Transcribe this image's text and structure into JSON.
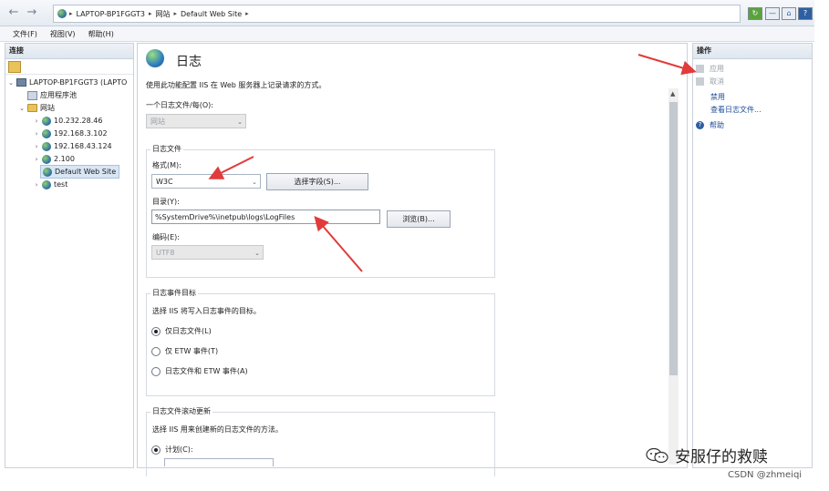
{
  "address": {
    "breadcrumbs": [
      "LAPTOP-BP1FGGT3",
      "网站",
      "Default Web Site"
    ],
    "separator": "▸"
  },
  "menu": [
    "文件(F)",
    "视图(V)",
    "帮助(H)"
  ],
  "connections": {
    "title": "连接",
    "tree": [
      {
        "label": "LAPTOP-BP1FGGT3 (LAPTO",
        "icon": "computer-icon"
      },
      {
        "label": "应用程序池",
        "icon": "app-pool-icon"
      },
      {
        "label": "网站",
        "icon": "folder-icon"
      },
      {
        "label": "10.232.28.46",
        "icon": "globe-icon"
      },
      {
        "label": "192.168.3.102",
        "icon": "globe-icon"
      },
      {
        "label": "192.168.43.124",
        "icon": "globe-icon"
      },
      {
        "label": "2.100",
        "icon": "globe-icon"
      },
      {
        "label": "Default Web Site",
        "icon": "globe-icon"
      },
      {
        "label": "test",
        "icon": "globe-icon"
      }
    ]
  },
  "page": {
    "title": "日志",
    "description": "使用此功能配置 IIS 在 Web 服务器上记录请求的方式。",
    "one_log_per_label": "一个日志文件/每(O):",
    "one_log_per_value": "网站",
    "log_file_group": "日志文件",
    "format_label": "格式(M):",
    "format_value": "W3C",
    "select_fields_button": "选择字段(S)...",
    "directory_label": "目录(Y):",
    "directory_value": "%SystemDrive%\\inetpub\\logs\\LogFiles",
    "browse_button": "浏览(B)...",
    "encoding_label": "编码(E):",
    "encoding_value": "UTF8",
    "event_dest_group": "日志事件目标",
    "event_dest_desc": "选择 IIS 将写入日志事件的目标。",
    "radio_log_only": "仅日志文件(L)",
    "radio_etw_only": "仅 ETW 事件(T)",
    "radio_both": "日志文件和 ETW 事件(A)",
    "rollover_group": "日志文件滚动更新",
    "rollover_desc": "选择 IIS 用来创建新的日志文件的方法。",
    "radio_schedule": "计划(C):"
  },
  "actions": {
    "title": "操作",
    "apply": "应用",
    "cancel": "取消",
    "disable": "禁用",
    "view_logs": "查看日志文件...",
    "help": "帮助"
  },
  "watermark": {
    "text": "安服仔的救赎",
    "credit": "CSDN @zhmeiqi"
  },
  "colors": {
    "annotation_arrow": "#e23b3b",
    "link": "#1c4c96",
    "disabled": "#9aa1a8"
  }
}
